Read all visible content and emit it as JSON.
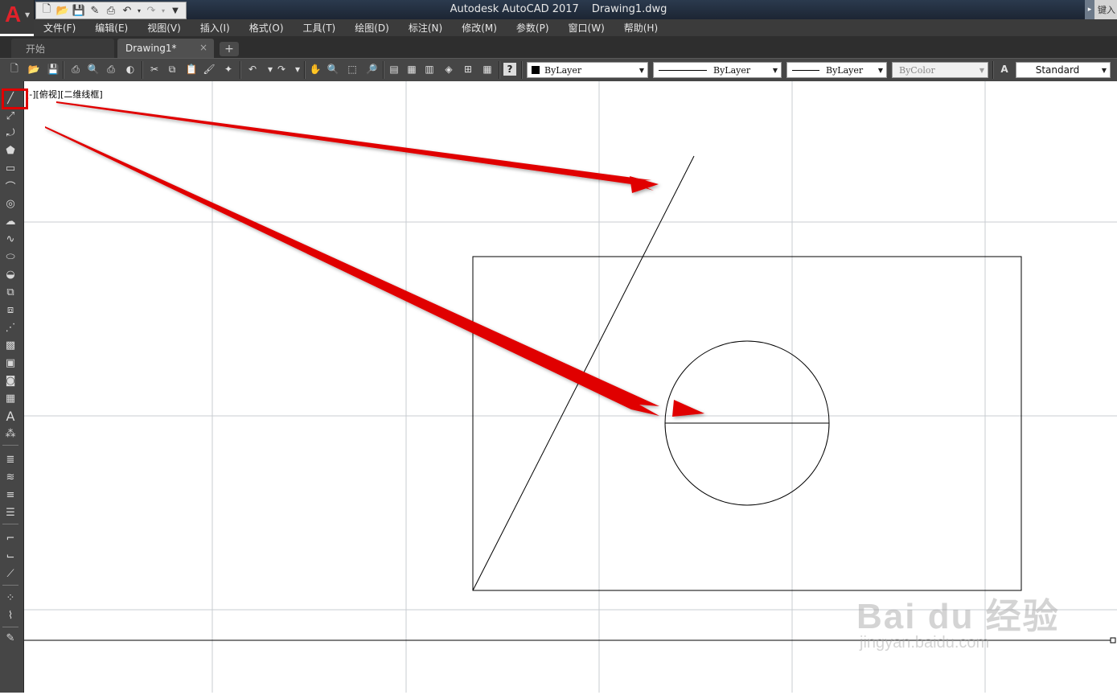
{
  "window": {
    "title": "Autodesk AutoCAD 2017",
    "filename": "Drawing1.dwg",
    "search_hint": "键入"
  },
  "app_button": {
    "logo": "A",
    "icon": "autocad-logo-icon"
  },
  "quick_access": [
    "new-icon",
    "open-icon",
    "save-icon",
    "saveas-icon",
    "print-icon",
    "undo-icon",
    "redo-icon",
    "customize-icon"
  ],
  "menu": [
    "文件(F)",
    "编辑(E)",
    "视图(V)",
    "插入(I)",
    "格式(O)",
    "工具(T)",
    "绘图(D)",
    "标注(N)",
    "修改(M)",
    "参数(P)",
    "窗口(W)",
    "帮助(H)"
  ],
  "tabs": {
    "start": "开始",
    "drawing": "Drawing1*",
    "close": "×",
    "add": "+"
  },
  "properties": {
    "color": "ByLayer",
    "linetype": "ByLayer",
    "lineweight": "ByLayer",
    "plotstyle": "ByColor",
    "textstyle": "Standard"
  },
  "viewport_label": "[-][俯视][二维线框]",
  "watermark": {
    "brand": "Bai du 经验",
    "url": "jingyan.baidu.com"
  },
  "colors": {
    "arrow": "#e00000",
    "highlight_box": "#e00000",
    "grid": "#c8ccd2",
    "geometry": "#000000"
  }
}
